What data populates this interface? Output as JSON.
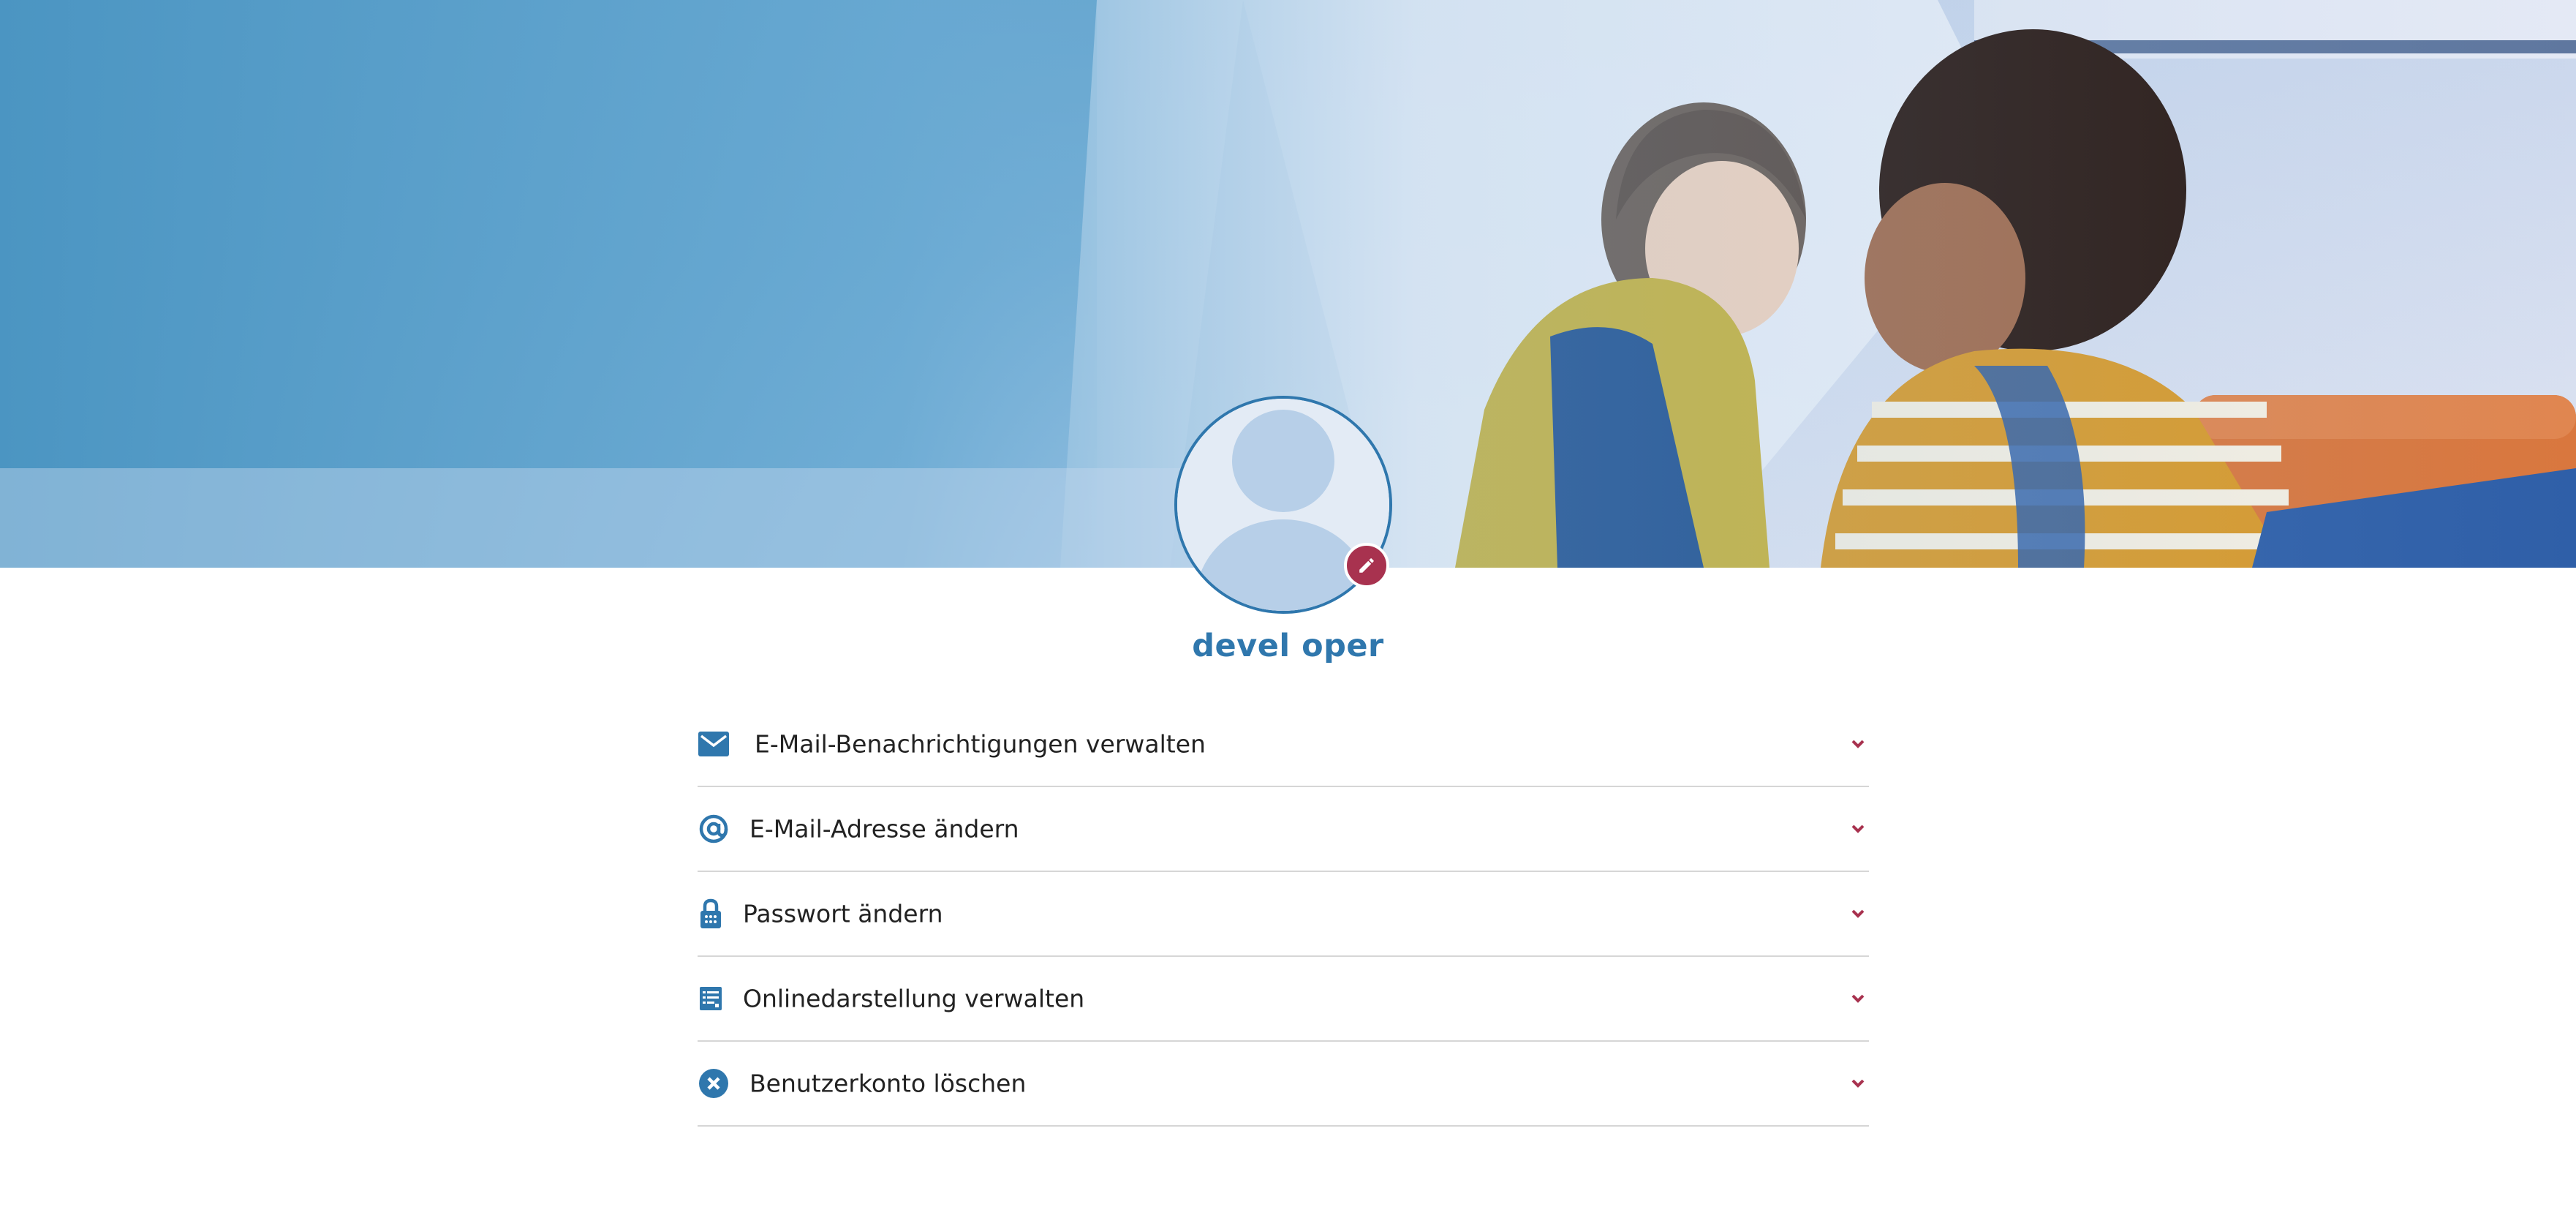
{
  "profile": {
    "name": "devel oper"
  },
  "menu": {
    "items": [
      {
        "icon": "envelope-icon",
        "label": "E-Mail-Benachrichtigungen verwalten"
      },
      {
        "icon": "at-sign-icon",
        "label": "E-Mail-Adresse ändern"
      },
      {
        "icon": "lock-icon",
        "label": "Passwort ändern"
      },
      {
        "icon": "list-document-icon",
        "label": "Onlinedarstellung verwalten"
      },
      {
        "icon": "close-circle-icon",
        "label": "Benutzerkonto löschen"
      }
    ]
  },
  "colors": {
    "primary": "#2f77ad",
    "accent": "#a8324f",
    "divider": "#d6d6d6",
    "text": "#222222"
  }
}
